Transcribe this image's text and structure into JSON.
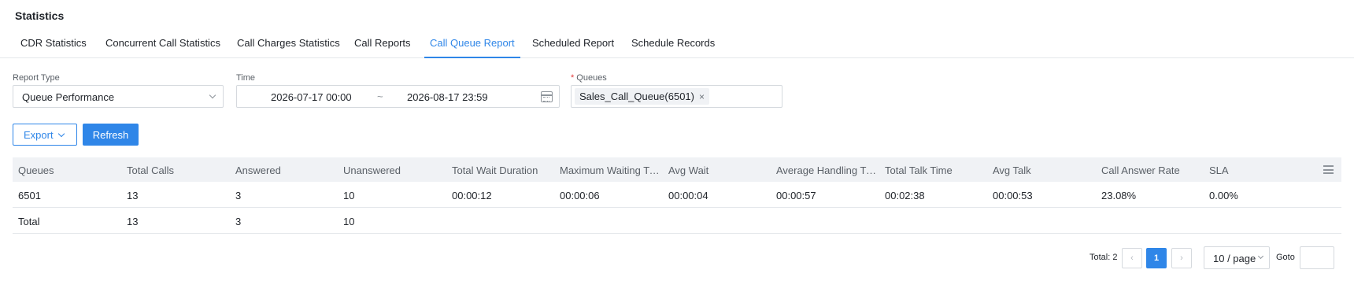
{
  "page": {
    "title": "Statistics"
  },
  "tabs": [
    {
      "label": "CDR Statistics"
    },
    {
      "label": "Concurrent Call Statistics"
    },
    {
      "label": "Call Charges Statistics"
    },
    {
      "label": "Call Reports"
    },
    {
      "label": "Call Queue Report"
    },
    {
      "label": "Scheduled Report"
    },
    {
      "label": "Schedule Records"
    }
  ],
  "active_tab": "Call Queue Report",
  "filters": {
    "report_type": {
      "label": "Report Type",
      "value": "Queue Performance"
    },
    "time": {
      "label": "Time",
      "start": "2026-07-17 00:00",
      "separator": "~",
      "end": "2026-08-17 23:59"
    },
    "queues": {
      "required_mark": "*",
      "label": "Queues",
      "selected": [
        "Sales_Call_Queue(6501)"
      ],
      "remove_glyph": "×"
    }
  },
  "toolbar": {
    "export_label": "Export",
    "refresh_label": "Refresh"
  },
  "table": {
    "columns": [
      "Queues",
      "Total Calls",
      "Answered",
      "Unanswered",
      "Total Wait Duration",
      "Maximum Waiting Time",
      "Avg Wait",
      "Average Handling Time",
      "Total Talk Time",
      "Avg Talk",
      "Call Answer Rate",
      "SLA"
    ],
    "rows": [
      [
        "6501",
        "13",
        "3",
        "10",
        "00:00:12",
        "00:00:06",
        "00:00:04",
        "00:00:57",
        "00:02:38",
        "00:00:53",
        "23.08%",
        "0.00%"
      ],
      [
        "Total",
        "13",
        "3",
        "10",
        "",
        "",
        "",
        "",
        "",
        "",
        "",
        ""
      ]
    ]
  },
  "pagination": {
    "total_text": "Total: 2",
    "prev_glyph": "‹",
    "current_page": "1",
    "next_glyph": "›",
    "page_size": "10 / page",
    "goto_label": "Goto",
    "goto_value": ""
  },
  "colors": {
    "accent": "#2f86e8",
    "header_bg": "#f0f2f5",
    "required": "#e23b3b",
    "border": "#d5d9de"
  },
  "icons": [
    "chevron-down-icon",
    "calendar-icon",
    "close-icon",
    "column-settings-icon",
    "chevron-left-icon",
    "chevron-right-icon"
  ]
}
